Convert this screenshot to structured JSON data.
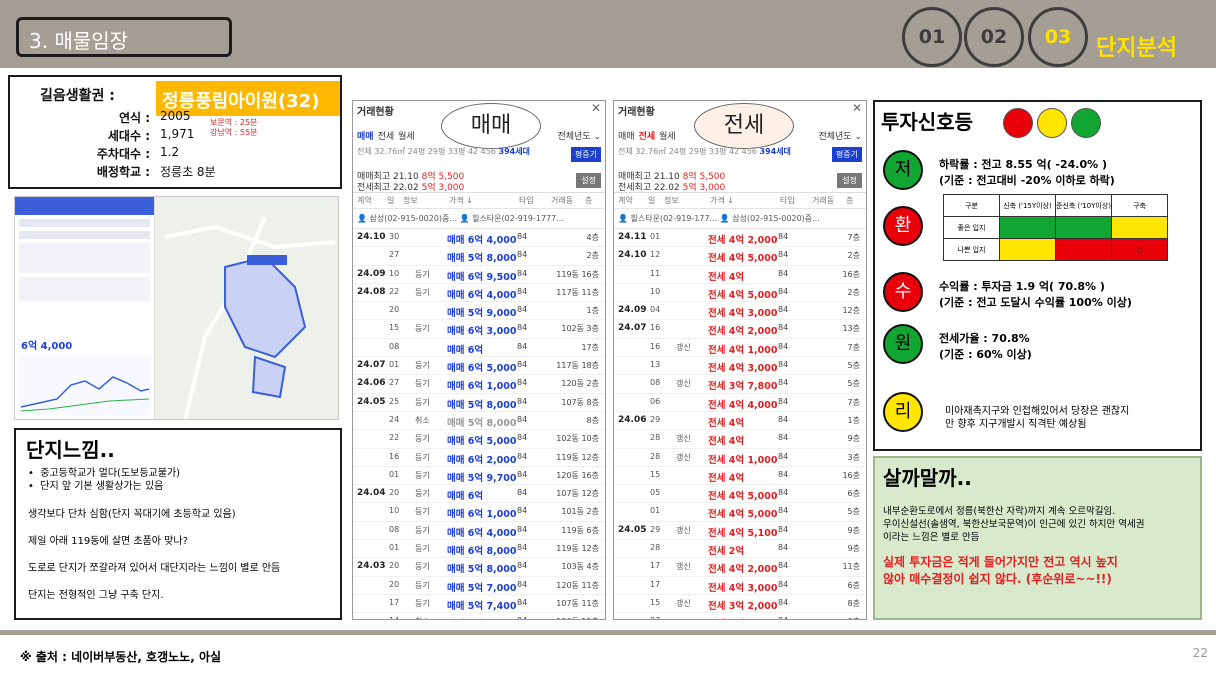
{
  "header": {
    "title": "3. 매물임장",
    "steps": [
      "01",
      "02",
      "03"
    ],
    "section_title": "단지분석"
  },
  "info": {
    "label_area": "길음생활권 :",
    "complex_name": "정릉풍림아이원(32)",
    "rows": [
      {
        "label": "연식 :",
        "value": "2005"
      },
      {
        "label": "세대수 :",
        "value": "1,971"
      },
      {
        "label": "주차대수 :",
        "value": "1.2"
      },
      {
        "label": "배정학교 :",
        "value": "정릉초 8분"
      }
    ],
    "stations": [
      "보문역 : 25분",
      "강남역 : 55분"
    ]
  },
  "map": {
    "price_label": "6억 4,000",
    "complex_label": "정릉풍림아이원"
  },
  "thoughts": {
    "title": "단지느낌..",
    "bullets": [
      "중고등학교가 멀다(도보등교불가)",
      "단지 앞 기본 생활상가는 있음"
    ],
    "lines": [
      "생각보다 단차 심함(단지 꼭대기에 초등학교 있음)",
      "제일 아래 119동에 살면 초품아 맞나?",
      "도로로 단지가 쪼갈라져 있어서 대단지라는 느낌이 별로 안듬",
      "단지는 전형적인 그냥 구축 단지."
    ]
  },
  "panel_common": {
    "head": "거래현황",
    "close": "✕",
    "tabs": [
      "매매",
      "전세",
      "월세"
    ],
    "year_select": "전체년도 ⌄",
    "sizes": "전체 32.76㎡ 24평 29평 33평 42 456",
    "sizes_bold": "394세대",
    "pyeong_button": "평증기",
    "setting_button": "설정",
    "col_headers": [
      "계약",
      "일",
      "정보",
      "가격 ↓",
      "타입",
      "거래동",
      "층"
    ]
  },
  "sale_panel": {
    "oval": "매매",
    "stat1_label": "매매최고 21.10",
    "stat1_value": "8억 5,500",
    "stat2_label": "전세최고 22.02",
    "stat2_value": "5억 3,000",
    "brokers": "👤 삼성(02-915-0020)중...  👤 힐스타운(02-919-1777...",
    "rows": [
      {
        "ym": "24.10",
        "d": "30",
        "k": "",
        "p": "매매 6억 4,000",
        "a": "84",
        "f": "4층"
      },
      {
        "ym": "",
        "d": "27",
        "k": "",
        "p": "매매 5억 8,000",
        "a": "84",
        "f": "2층"
      },
      {
        "ym": "24.09",
        "d": "10",
        "k": "등기",
        "p": "매매 6억 9,500",
        "a": "84",
        "f": "119동 16층"
      },
      {
        "ym": "24.08",
        "d": "22",
        "k": "등기",
        "p": "매매 6억 4,000",
        "a": "84",
        "f": "117동 11층"
      },
      {
        "ym": "",
        "d": "20",
        "k": "",
        "p": "매매 5억 9,000",
        "a": "84",
        "f": "1층"
      },
      {
        "ym": "",
        "d": "15",
        "k": "등기",
        "p": "매매 6억 3,000",
        "a": "84",
        "f": "102동 3층"
      },
      {
        "ym": "",
        "d": "08",
        "k": "",
        "p": "매매 6억",
        "a": "84",
        "f": "17층"
      },
      {
        "ym": "24.07",
        "d": "01",
        "k": "등기",
        "p": "매매 6억 5,000",
        "a": "84",
        "f": "117동 18층"
      },
      {
        "ym": "24.06",
        "d": "27",
        "k": "등기",
        "p": "매매 6억 1,000",
        "a": "84",
        "f": "120동 2층"
      },
      {
        "ym": "24.05",
        "d": "25",
        "k": "등기",
        "p": "매매 5억 8,000",
        "a": "84",
        "f": "107동 8층"
      },
      {
        "ym": "",
        "d": "24",
        "k": "취소",
        "p": "매매 5억 8,000",
        "a": "84",
        "f": "8층"
      },
      {
        "ym": "",
        "d": "22",
        "k": "등기",
        "p": "매매 6억 5,000",
        "a": "84",
        "f": "102동 10층"
      },
      {
        "ym": "",
        "d": "16",
        "k": "등기",
        "p": "매매 6억 2,000",
        "a": "84",
        "f": "119동 12층"
      },
      {
        "ym": "",
        "d": "01",
        "k": "등기",
        "p": "매매 5억 9,700",
        "a": "84",
        "f": "120동 16층"
      },
      {
        "ym": "24.04",
        "d": "20",
        "k": "등기",
        "p": "매매 6억",
        "a": "84",
        "f": "107동 12층"
      },
      {
        "ym": "",
        "d": "10",
        "k": "등기",
        "p": "매매 6억 1,000",
        "a": "84",
        "f": "101동 2층"
      },
      {
        "ym": "",
        "d": "08",
        "k": "등기",
        "p": "매매 6억 4,000",
        "a": "84",
        "f": "119동 6층"
      },
      {
        "ym": "",
        "d": "01",
        "k": "등기",
        "p": "매매 6억 8,000",
        "a": "84",
        "f": "119동 12층"
      },
      {
        "ym": "24.03",
        "d": "20",
        "k": "등기",
        "p": "매매 5억 8,000",
        "a": "84",
        "f": "103동 4층"
      },
      {
        "ym": "",
        "d": "20",
        "k": "등기",
        "p": "매매 5억 7,000",
        "a": "84",
        "f": "120동 11층"
      },
      {
        "ym": "",
        "d": "17",
        "k": "등기",
        "p": "매매 5억 7,400",
        "a": "84",
        "f": "107동 11층"
      },
      {
        "ym": "",
        "d": "14",
        "k": "취소",
        "p": "매매 5억 7,000",
        "a": "84",
        "f": "120동 11층"
      }
    ]
  },
  "jeonse_panel": {
    "oval": "전세",
    "stat1_label": "매매최고 21.10",
    "stat1_value": "8억 5,500",
    "stat2_label": "전세최고 22.02",
    "stat2_value": "5억 3,000",
    "brokers": "👤 힐스타운(02-919-177...  👤 삼성(02-915-0020)중...",
    "rows": [
      {
        "ym": "24.11",
        "d": "01",
        "k": "",
        "p": "전세 4억 2,000",
        "a": "84",
        "f": "7층"
      },
      {
        "ym": "24.10",
        "d": "12",
        "k": "",
        "p": "전세 4억 5,000",
        "a": "84",
        "f": "2층"
      },
      {
        "ym": "",
        "d": "11",
        "k": "",
        "p": "전세 4억",
        "a": "84",
        "f": "16층"
      },
      {
        "ym": "",
        "d": "10",
        "k": "",
        "p": "전세 4억 5,000",
        "a": "84",
        "f": "2층"
      },
      {
        "ym": "24.09",
        "d": "04",
        "k": "",
        "p": "전세 4억 3,000",
        "a": "84",
        "f": "12층"
      },
      {
        "ym": "24.07",
        "d": "16",
        "k": "",
        "p": "전세 4억 2,000",
        "a": "84",
        "f": "13층"
      },
      {
        "ym": "",
        "d": "16",
        "k": "갱신",
        "p": "전세 4억 1,000",
        "a": "84",
        "f": "7층"
      },
      {
        "ym": "",
        "d": "13",
        "k": "",
        "p": "전세 4억 3,000",
        "a": "84",
        "f": "5층"
      },
      {
        "ym": "",
        "d": "08",
        "k": "갱신",
        "p": "전세 3억 7,800",
        "a": "84",
        "f": "5층"
      },
      {
        "ym": "",
        "d": "06",
        "k": "",
        "p": "전세 4억 4,000",
        "a": "84",
        "f": "7층"
      },
      {
        "ym": "24.06",
        "d": "29",
        "k": "",
        "p": "전세 4억",
        "a": "84",
        "f": "1층"
      },
      {
        "ym": "",
        "d": "28",
        "k": "갱신",
        "p": "전세 4억",
        "a": "84",
        "f": "9층"
      },
      {
        "ym": "",
        "d": "28",
        "k": "갱신",
        "p": "전세 4억 1,000",
        "a": "84",
        "f": "3층"
      },
      {
        "ym": "",
        "d": "15",
        "k": "",
        "p": "전세 4억",
        "a": "84",
        "f": "16층"
      },
      {
        "ym": "",
        "d": "05",
        "k": "",
        "p": "전세 4억 5,000",
        "a": "84",
        "f": "6층"
      },
      {
        "ym": "",
        "d": "01",
        "k": "",
        "p": "전세 4억 5,000",
        "a": "84",
        "f": "5층"
      },
      {
        "ym": "24.05",
        "d": "29",
        "k": "갱신",
        "p": "전세 4억 5,100",
        "a": "84",
        "f": "9층"
      },
      {
        "ym": "",
        "d": "28",
        "k": "",
        "p": "전세 2억",
        "a": "84",
        "f": "9층"
      },
      {
        "ym": "",
        "d": "17",
        "k": "갱신",
        "p": "전세 4억 2,000",
        "a": "84",
        "f": "11층"
      },
      {
        "ym": "",
        "d": "17",
        "k": "",
        "p": "전세 4억 3,000",
        "a": "84",
        "f": "6층"
      },
      {
        "ym": "",
        "d": "15",
        "k": "갱신",
        "p": "전세 3억 2,000",
        "a": "84",
        "f": "8층"
      },
      {
        "ym": "",
        "d": "07",
        "k": "",
        "p": "전세 4억",
        "a": "84",
        "f": "9층"
      }
    ]
  },
  "signal": {
    "title": "투자신호등",
    "lamps": [
      "#e8000b",
      "#ffe500",
      "#11a532"
    ],
    "items": [
      {
        "char": "저",
        "color": "#11a532",
        "line1": "하락률 : 전고          8.55 억(       -24.0% )",
        "line2": "(기준 : 전고대비 -20% 이하로 하락)"
      },
      {
        "char": "환",
        "color": "#e8000b"
      },
      {
        "char": "수",
        "color": "#e8000b",
        "line1": "수익률 : 투자금         1.9 억(       70.8% )",
        "line2": "(기준 : 전고 도달시 수익률 100% 이상)"
      },
      {
        "char": "원",
        "color": "#11a532",
        "line1": "전세가율 :               70.8%",
        "line2": "(기준 : 60% 이상)"
      },
      {
        "char": "리",
        "color": "#ffe500",
        "line1": "미아재촉지구와 인접해있어서 당장은 괜찮지",
        "line2": "만 향후 지구개발시 직격탄 예상됨"
      }
    ],
    "matrix": {
      "headers": [
        "구분",
        "신축 ('15Y이상)",
        "준신축 ('10Y이상)",
        "구축"
      ],
      "rows": [
        {
          "label": "좋은 입지",
          "cells": [
            "#11a532",
            "#11a532",
            "#ffe500"
          ]
        },
        {
          "label": "나쁜 입지",
          "cells": [
            "#ffe500",
            "#e8000b",
            "#e8000b"
          ]
        }
      ],
      "mark": "○"
    }
  },
  "conclusion": {
    "title": "살까말까..",
    "text1": "내부순환도로에서 정릉(북한산 자락)까지 계속 오르막길임.",
    "text2": "우이신설선(솔샘역, 북한산보국문역)이 인근에 있긴 하지만 역세권",
    "text3": "이라는 느낌은 별로 안듬",
    "red1": "실제 투자금은 적게 들어가지만 전고 역시 높지",
    "red2": "않아 매수결정이 쉽지 않다. (후순위로~~!!)"
  },
  "footer": {
    "source": "※ 출처 : 네이버부동산, 호갱노노, 아실",
    "page": "22"
  }
}
